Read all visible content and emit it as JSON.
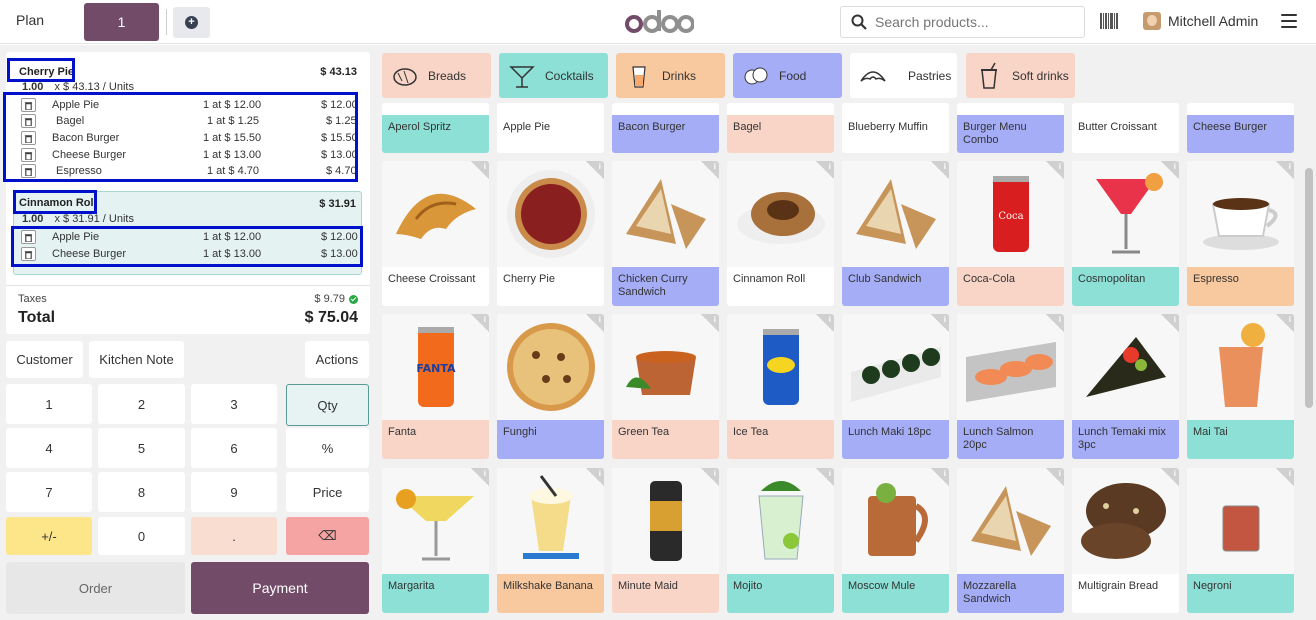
{
  "header": {
    "plan_label": "Plan",
    "order_tab": "1",
    "logo": "odoo",
    "search_placeholder": "Search products...",
    "user_name": "Mitchell Admin"
  },
  "order": {
    "lines": [
      {
        "name": "Cherry Pie",
        "price": "$ 43.13",
        "qty": "1.00",
        "unit_info": "x $ 43.13 / Units",
        "combo": [
          {
            "name": "Apple Pie",
            "detail": "1 at $ 12.00",
            "price": "$ 12.00"
          },
          {
            "name": "Bagel",
            "detail": "1 at $ 1.25",
            "price": "$ 1.25"
          },
          {
            "name": "Bacon Burger",
            "detail": "1 at $ 15.50",
            "price": "$ 15.50"
          },
          {
            "name": "Cheese Burger",
            "detail": "1 at $ 13.00",
            "price": "$ 13.00"
          },
          {
            "name": "Espresso",
            "detail": "1 at $ 4.70",
            "price": "$ 4.70"
          }
        ]
      },
      {
        "name": "Cinnamon Roll",
        "price": "$ 31.91",
        "qty": "1.00",
        "unit_info": "x $ 31.91 / Units",
        "combo": [
          {
            "name": "Apple Pie",
            "detail": "1 at $ 12.00",
            "price": "$ 12.00"
          },
          {
            "name": "Cheese Burger",
            "detail": "1 at $ 13.00",
            "price": "$ 13.00"
          }
        ]
      }
    ],
    "taxes_label": "Taxes",
    "taxes_value": "$ 9.79",
    "total_label": "Total",
    "total_value": "$ 75.04"
  },
  "actions": {
    "customer": "Customer",
    "kitchen_note": "Kitchen Note",
    "actions": "Actions",
    "order": "Order",
    "payment": "Payment"
  },
  "numpad": {
    "k1": "1",
    "k2": "2",
    "k3": "3",
    "qty": "Qty",
    "k4": "4",
    "k5": "5",
    "k6": "6",
    "pct": "%",
    "k7": "7",
    "k8": "8",
    "k9": "9",
    "price": "Price",
    "plusminus": "+/-",
    "k0": "0",
    "dot": ".",
    "backspace": "⌫"
  },
  "categories": [
    {
      "label": "Breads",
      "color": "#f9d5c8",
      "icon": "bread-icon"
    },
    {
      "label": "Cocktails",
      "color": "#8de0d6",
      "icon": "cocktail-icon"
    },
    {
      "label": "Drinks",
      "color": "#f8c89e",
      "icon": "drink-icon"
    },
    {
      "label": "Food",
      "color": "#a5adf6",
      "icon": "food-icon"
    },
    {
      "label": "Pastries",
      "color": "#ffffff",
      "icon": "croissant-icon"
    },
    {
      "label": "Soft drinks",
      "color": "#f9d5c8",
      "icon": "soft-drink-icon"
    }
  ],
  "products_row0": [
    {
      "name": "Aperol Spritz",
      "color": "#8de0d6"
    },
    {
      "name": "Apple Pie",
      "color": "#ffffff"
    },
    {
      "name": "Bacon Burger",
      "color": "#a5adf6"
    },
    {
      "name": "Bagel",
      "color": "#f9d5c8"
    },
    {
      "name": "Blueberry Muffin",
      "color": "#ffffff"
    },
    {
      "name": "Burger Menu Combo",
      "color": "#a5adf6"
    },
    {
      "name": "Butter Croissant",
      "color": "#ffffff"
    },
    {
      "name": "Cheese Burger",
      "color": "#a5adf6"
    }
  ],
  "products_row1": [
    {
      "name": "Cheese Croissant",
      "color": "#ffffff",
      "art": "croissant"
    },
    {
      "name": "Cherry Pie",
      "color": "#ffffff",
      "art": "pie"
    },
    {
      "name": "Chicken Curry Sandwich",
      "color": "#a5adf6",
      "art": "sandwich"
    },
    {
      "name": "Cinnamon Roll",
      "color": "#ffffff",
      "art": "roll"
    },
    {
      "name": "Club Sandwich",
      "color": "#a5adf6",
      "art": "sandwich"
    },
    {
      "name": "Coca-Cola",
      "color": "#f9d5c8",
      "art": "can-red"
    },
    {
      "name": "Cosmopolitan",
      "color": "#8de0d6",
      "art": "cocktail-red"
    },
    {
      "name": "Espresso",
      "color": "#f8c89e",
      "art": "cup"
    }
  ],
  "products_row2": [
    {
      "name": "Fanta",
      "color": "#f9d5c8",
      "art": "can-orange"
    },
    {
      "name": "Funghi",
      "color": "#a5adf6",
      "art": "pizza"
    },
    {
      "name": "Green Tea",
      "color": "#f9d5c8",
      "art": "tea"
    },
    {
      "name": "Ice Tea",
      "color": "#f9d5c8",
      "art": "can-blue"
    },
    {
      "name": "Lunch Maki 18pc",
      "color": "#a5adf6",
      "art": "sushi"
    },
    {
      "name": "Lunch Salmon 20pc",
      "color": "#a5adf6",
      "art": "salmon"
    },
    {
      "name": "Lunch Temaki mix 3pc",
      "color": "#a5adf6",
      "art": "temaki"
    },
    {
      "name": "Mai Tai",
      "color": "#8de0d6",
      "art": "cocktail-orange"
    }
  ],
  "products_row3": [
    {
      "name": "Margarita",
      "color": "#8de0d6",
      "art": "margarita"
    },
    {
      "name": "Milkshake Banana",
      "color": "#f8c89e",
      "art": "milkshake"
    },
    {
      "name": "Minute Maid",
      "color": "#f9d5c8",
      "art": "can-dark"
    },
    {
      "name": "Mojito",
      "color": "#8de0d6",
      "art": "mojito"
    },
    {
      "name": "Moscow Mule",
      "color": "#8de0d6",
      "art": "mug"
    },
    {
      "name": "Mozzarella Sandwich",
      "color": "#a5adf6",
      "art": "sandwich"
    },
    {
      "name": "Multigrain Bread",
      "color": "#ffffff",
      "art": "bread"
    },
    {
      "name": "Negroni",
      "color": "#8de0d6",
      "art": "negroni"
    }
  ]
}
